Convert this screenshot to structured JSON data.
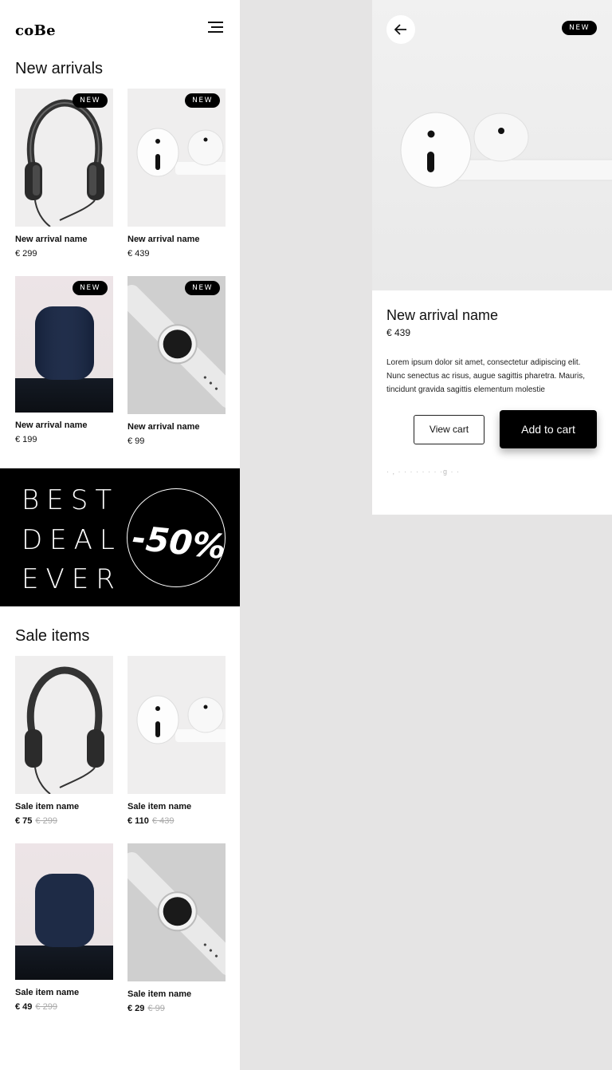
{
  "brand": {
    "logo": "coBe"
  },
  "new_arrivals": {
    "title": "New arrivals",
    "items": [
      {
        "name": "New arrival name",
        "price": "€ 299",
        "badge": "NEW",
        "image": "headphones"
      },
      {
        "name": "New arrival name",
        "price": "€ 439",
        "badge": "NEW",
        "image": "earbuds"
      },
      {
        "name": "New arrival name",
        "price": "€ 199",
        "badge": "NEW",
        "image": "smart-speaker"
      },
      {
        "name": "New arrival name",
        "price": "€ 99",
        "badge": "NEW",
        "image": "smartwatch"
      }
    ]
  },
  "promo": {
    "lines": [
      "BEST",
      "DEAL",
      "EVER"
    ],
    "discount": "-50%"
  },
  "sale_items": {
    "title": "Sale items",
    "items": [
      {
        "name": "Sale item name",
        "price": "€ 75",
        "old_price": "€ 299",
        "image": "headphones"
      },
      {
        "name": "Sale item name",
        "price": "€ 110",
        "old_price": "€ 439",
        "image": "earbuds"
      },
      {
        "name": "Sale item name",
        "price": "€ 49",
        "old_price": "€ 299",
        "image": "smart-speaker"
      },
      {
        "name": "Sale item name",
        "price": "€ 29",
        "old_price": "€ 99",
        "image": "smartwatch"
      }
    ]
  },
  "detail": {
    "badge": "NEW",
    "title": "New arrival name",
    "price": "€ 439",
    "description": "Lorem ipsum dolor sit amet, consectetur adipiscing elit. Nunc senectus ac risus, augue sagittis pharetra. Mauris, tincidunt gravida sagittis elementum molestie",
    "view_cart": "View cart",
    "add_to_cart": "Add to cart",
    "overflow_text": "· , · · · · · · · ·g · ·"
  },
  "icons": {
    "menu": "hamburger-icon",
    "back": "arrow-left-icon"
  }
}
